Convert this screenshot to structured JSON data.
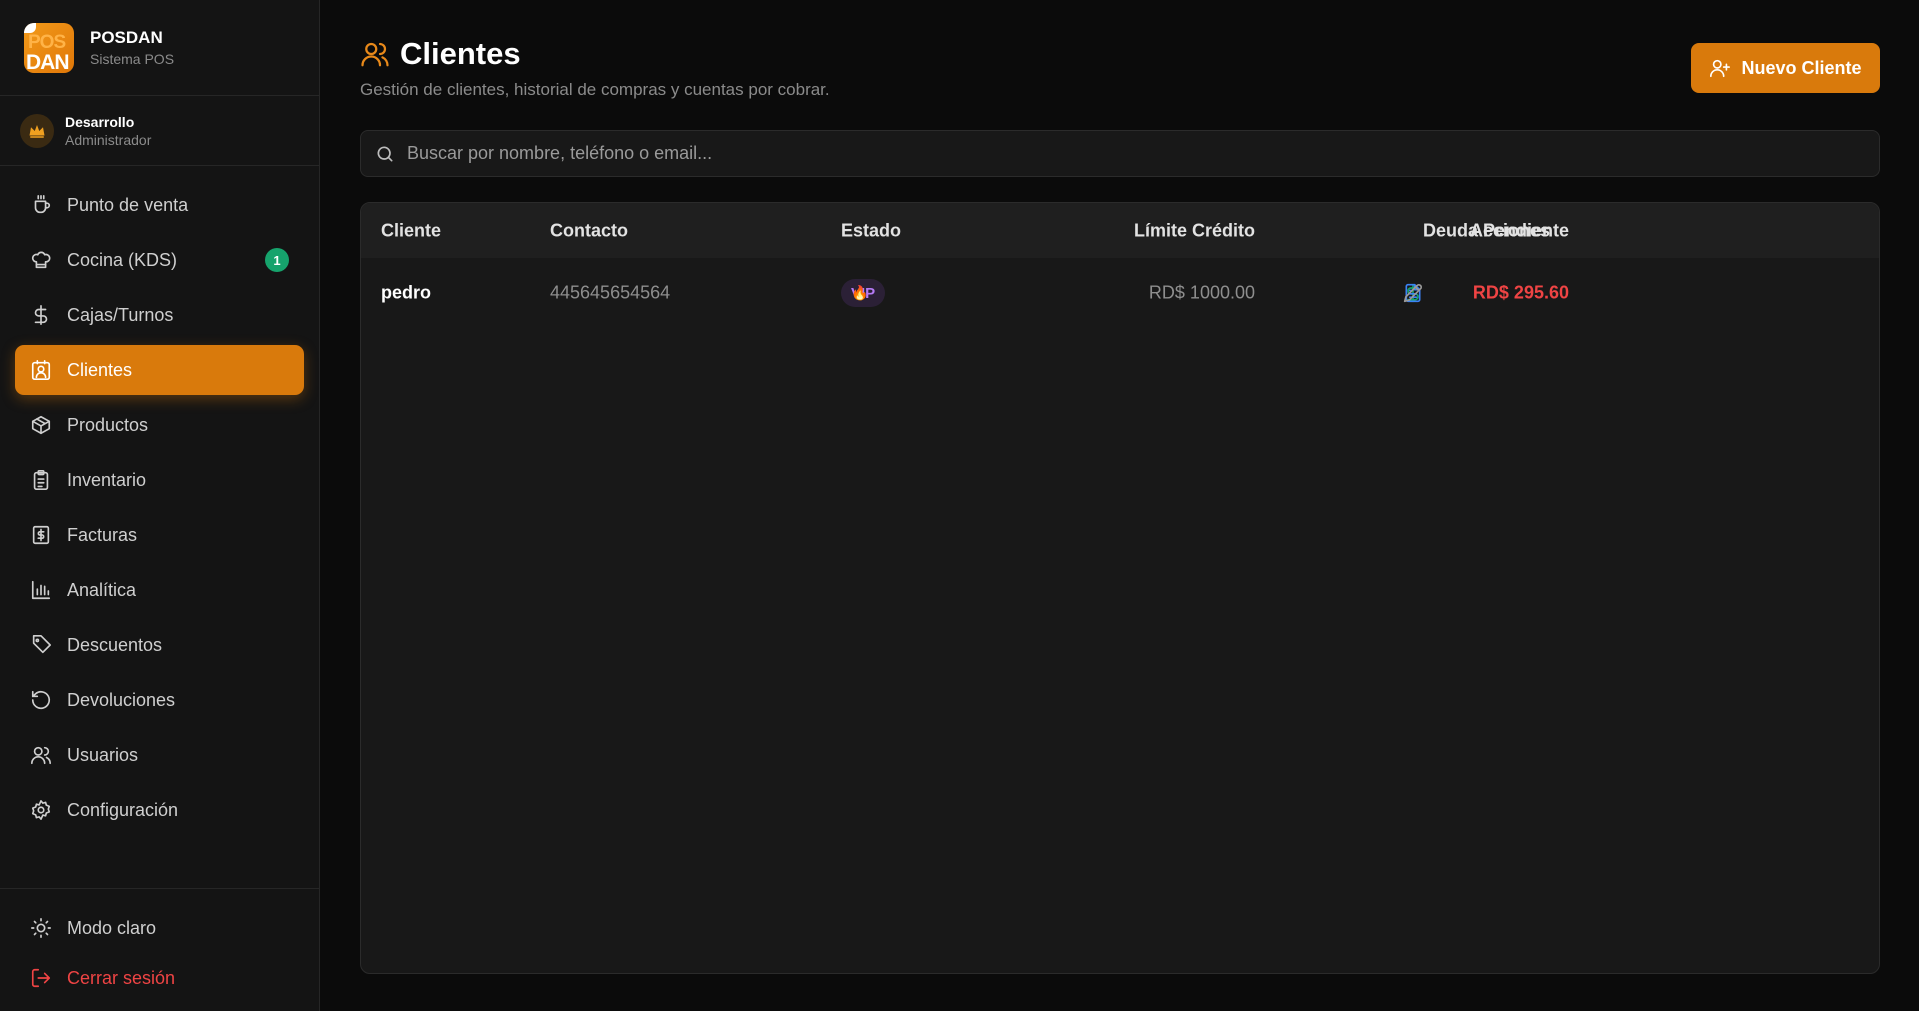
{
  "brand": {
    "logo_text_top": "POS",
    "logo_text_bottom": "DAN",
    "name": "POSDAN",
    "subtitle": "Sistema POS"
  },
  "user": {
    "name": "Desarrollo",
    "role": "Administrador",
    "avatar_icon": "crown-icon"
  },
  "nav": {
    "items": [
      {
        "label": "Punto de venta",
        "icon": "coffee-cup-icon"
      },
      {
        "label": "Cocina (KDS)",
        "icon": "chef-hat-icon",
        "badge": "1"
      },
      {
        "label": "Cajas/Turnos",
        "icon": "dollar-icon"
      },
      {
        "label": "Clientes",
        "icon": "contact-card-icon",
        "active": true
      },
      {
        "label": "Productos",
        "icon": "package-icon"
      },
      {
        "label": "Inventario",
        "icon": "clipboard-icon"
      },
      {
        "label": "Facturas",
        "icon": "receipt-icon"
      },
      {
        "label": "Analítica",
        "icon": "bar-chart-icon"
      },
      {
        "label": "Descuentos",
        "icon": "tag-icon"
      },
      {
        "label": "Devoluciones",
        "icon": "rotate-ccw-icon"
      },
      {
        "label": "Usuarios",
        "icon": "users-icon"
      },
      {
        "label": "Configuración",
        "icon": "gear-icon"
      }
    ]
  },
  "sidebar_bottom": {
    "theme_label": "Modo claro",
    "logout_label": "Cerrar sesión"
  },
  "header": {
    "title": "Clientes",
    "subtitle": "Gestión de clientes, historial de compras y cuentas por cobrar.",
    "new_button": "Nuevo Cliente"
  },
  "search": {
    "placeholder": "Buscar por nombre, teléfono o email..."
  },
  "table": {
    "columns": [
      "Cliente",
      "Contacto",
      "Estado",
      "Límite Crédito",
      "Deuda Pendiente",
      "Acciones"
    ],
    "rows": [
      {
        "cliente": "pedro",
        "contacto": "445645654564",
        "estado": "VIP",
        "limite": "RD$ 1000.00",
        "deuda": "RD$ 295.60"
      }
    ]
  },
  "colors": {
    "accent": "#d97a0c",
    "danger": "#ef4444",
    "success": "#16a36c",
    "vip": "#b57af5",
    "info": "#3b82f6"
  }
}
